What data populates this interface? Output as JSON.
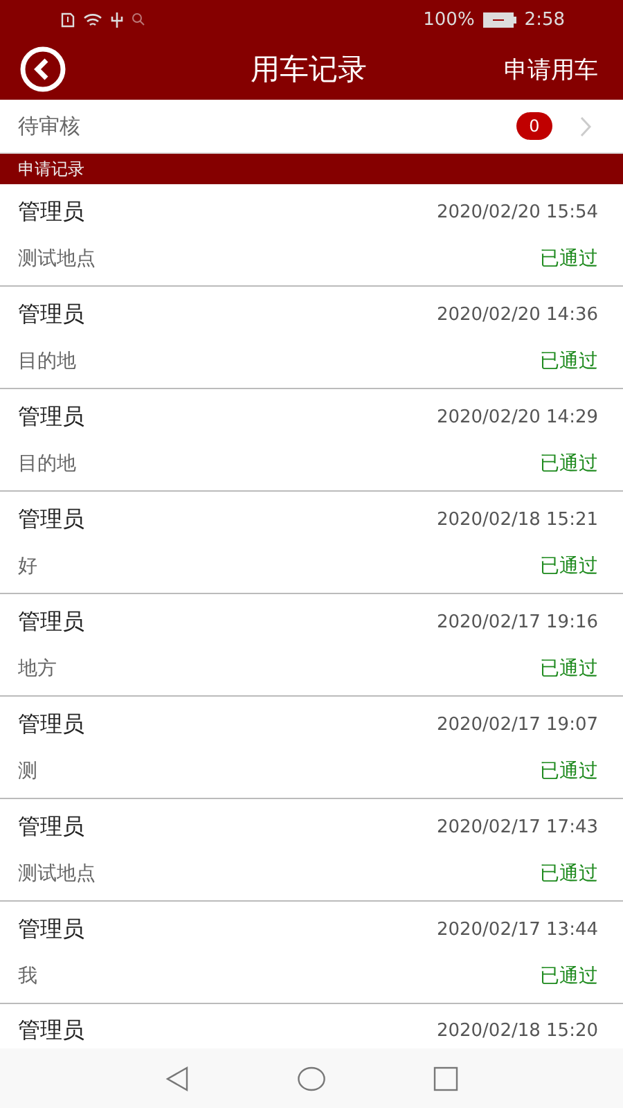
{
  "status_bar": {
    "battery": "100%",
    "time": "2:58"
  },
  "header": {
    "title": "用车记录",
    "action": "申请用车"
  },
  "pending": {
    "label": "待审核",
    "count": "0"
  },
  "section": {
    "label": "申请记录"
  },
  "records": [
    {
      "name": "管理员",
      "time": "2020/02/20 15:54",
      "place": "测试地点",
      "status": "已通过"
    },
    {
      "name": "管理员",
      "time": "2020/02/20 14:36",
      "place": "目的地",
      "status": "已通过"
    },
    {
      "name": "管理员",
      "time": "2020/02/20 14:29",
      "place": "目的地",
      "status": "已通过"
    },
    {
      "name": "管理员",
      "time": "2020/02/18 15:21",
      "place": "好",
      "status": "已通过"
    },
    {
      "name": "管理员",
      "time": "2020/02/17 19:16",
      "place": "地方",
      "status": "已通过"
    },
    {
      "name": "管理员",
      "time": "2020/02/17 19:07",
      "place": "测",
      "status": "已通过"
    },
    {
      "name": "管理员",
      "time": "2020/02/17 17:43",
      "place": "测试地点",
      "status": "已通过"
    },
    {
      "name": "管理员",
      "time": "2020/02/17 13:44",
      "place": "我",
      "status": "已通过"
    },
    {
      "name": "管理员",
      "time": "2020/02/18 15:20"
    }
  ]
}
